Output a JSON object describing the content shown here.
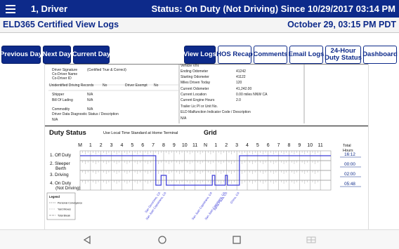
{
  "header": {
    "driver": "1, Driver",
    "status": "Status: On Duty (Not Driving) Since 10/29/2017 03:14 PM"
  },
  "subheader": {
    "title": "ELD365 Certified View Logs",
    "date": "October 29, 03:15 PM PDT"
  },
  "toolbar": {
    "previous_day": "Previous Day",
    "next_day": "Next Day",
    "current_day": "Current Day",
    "view_logs": "View Logs",
    "hos_recap": "HOS Recap",
    "comments": "Comments",
    "email_logs": "Email Logs",
    "hour_status_line1": "24-Hour",
    "hour_status_line2": "Duty Status",
    "dashboard": "Dashboard"
  },
  "log_info": {
    "driver_signature": "Driver Signature",
    "certified": "(Certified True & Correct)",
    "co_driver_name": "Co-Driver Name",
    "co_driver_id": "Co-Driver ID",
    "unidentified_records": "Unidentified Driving Records",
    "unidentified_value": "No",
    "driver_exempt": "Driver Exempt",
    "driver_exempt_value": "No",
    "shipper_label": "Shipper",
    "shipper_value": "N/A",
    "bol_label": "Bill Of Lading",
    "bol_value": "N/A",
    "commodity_label": "Commodity",
    "commodity_value": "N/A",
    "diag_label": "Driver Data Diagnostic Status / Description",
    "diag_value": "N/A",
    "vehicle_vin": "Vehicle VIN",
    "ending_odometer": "Ending Odometer",
    "ending_odometer_value": "41242",
    "starting_odometer": "Starting Odometer",
    "starting_odometer_value": "41122",
    "miles_today": "Miles Driven Today",
    "miles_today_value": "120",
    "current_odometer": "Current Odometer",
    "current_odometer_value": "41,242.00",
    "current_location": "Current Location",
    "current_location_value": "0.00 miles NNW CA",
    "current_engine_hours": "Current Engine Hours",
    "current_engine_hours_value": "2.0",
    "trailer": "Trailer Lic Pl or Unit No.",
    "malfunction": "ELD Malfunction Indicator Code / Description",
    "malfunction_value": "N/A"
  },
  "duty_chart": {
    "title": "Duty Status",
    "subtitle": "Use Local Time Standard at Home Terminal",
    "grid_label": "Grid",
    "total_label": "Total\nHours",
    "hour_labels": [
      "M",
      "1",
      "2",
      "3",
      "4",
      "5",
      "6",
      "7",
      "8",
      "9",
      "10",
      "11",
      "N",
      "1",
      "2",
      "3",
      "4",
      "5",
      "6",
      "7",
      "8",
      "9",
      "10",
      "11"
    ],
    "rows": [
      {
        "label": "1. Off Duty",
        "total": "16:12"
      },
      {
        "label": "2. Sleeper Berth",
        "total": "00:00"
      },
      {
        "label": "3. Driving",
        "total": "02:00"
      },
      {
        "label": "4. On Duty (Not Driving)",
        "total": "05:48"
      }
    ],
    "segments": [
      {
        "row": 0,
        "start": 0.0,
        "end": 7.25
      },
      {
        "row": 3,
        "start": 7.25,
        "end": 7.75
      },
      {
        "row": 2,
        "start": 7.75,
        "end": 8.25
      },
      {
        "row": 3,
        "start": 8.25,
        "end": 12.65
      },
      {
        "row": 2,
        "start": 12.65,
        "end": 12.9
      },
      {
        "row": 3,
        "start": 12.9,
        "end": 13.9
      },
      {
        "row": 2,
        "start": 13.9,
        "end": 14.1
      },
      {
        "row": 3,
        "start": 14.1,
        "end": 15.25
      },
      {
        "row": 0,
        "start": 15.25,
        "end": 24.0
      }
    ],
    "locations": [
      "San Geronimo, CA",
      "San Juan Capistrano, CA",
      "San Juan Capistrano, CA",
      "San Juan Capistrano, CA",
      "Santa Paula, CA",
      "Chino, CA"
    ],
    "location_hours": [
      7.7,
      8.25,
      12.65,
      13.9,
      14.1,
      15.25
    ],
    "legend_title": "Legend",
    "legend_items": [
      "Personal Conveyance",
      "Yard Moves",
      "Total Break"
    ],
    "colors": {
      "line": "#3a3ad8",
      "grid": "#9a9a9a",
      "accent": "#0d2a8a"
    }
  },
  "navbar": {
    "icons": [
      "back-icon",
      "home-icon",
      "recents-icon",
      "keyboard-icon"
    ]
  }
}
